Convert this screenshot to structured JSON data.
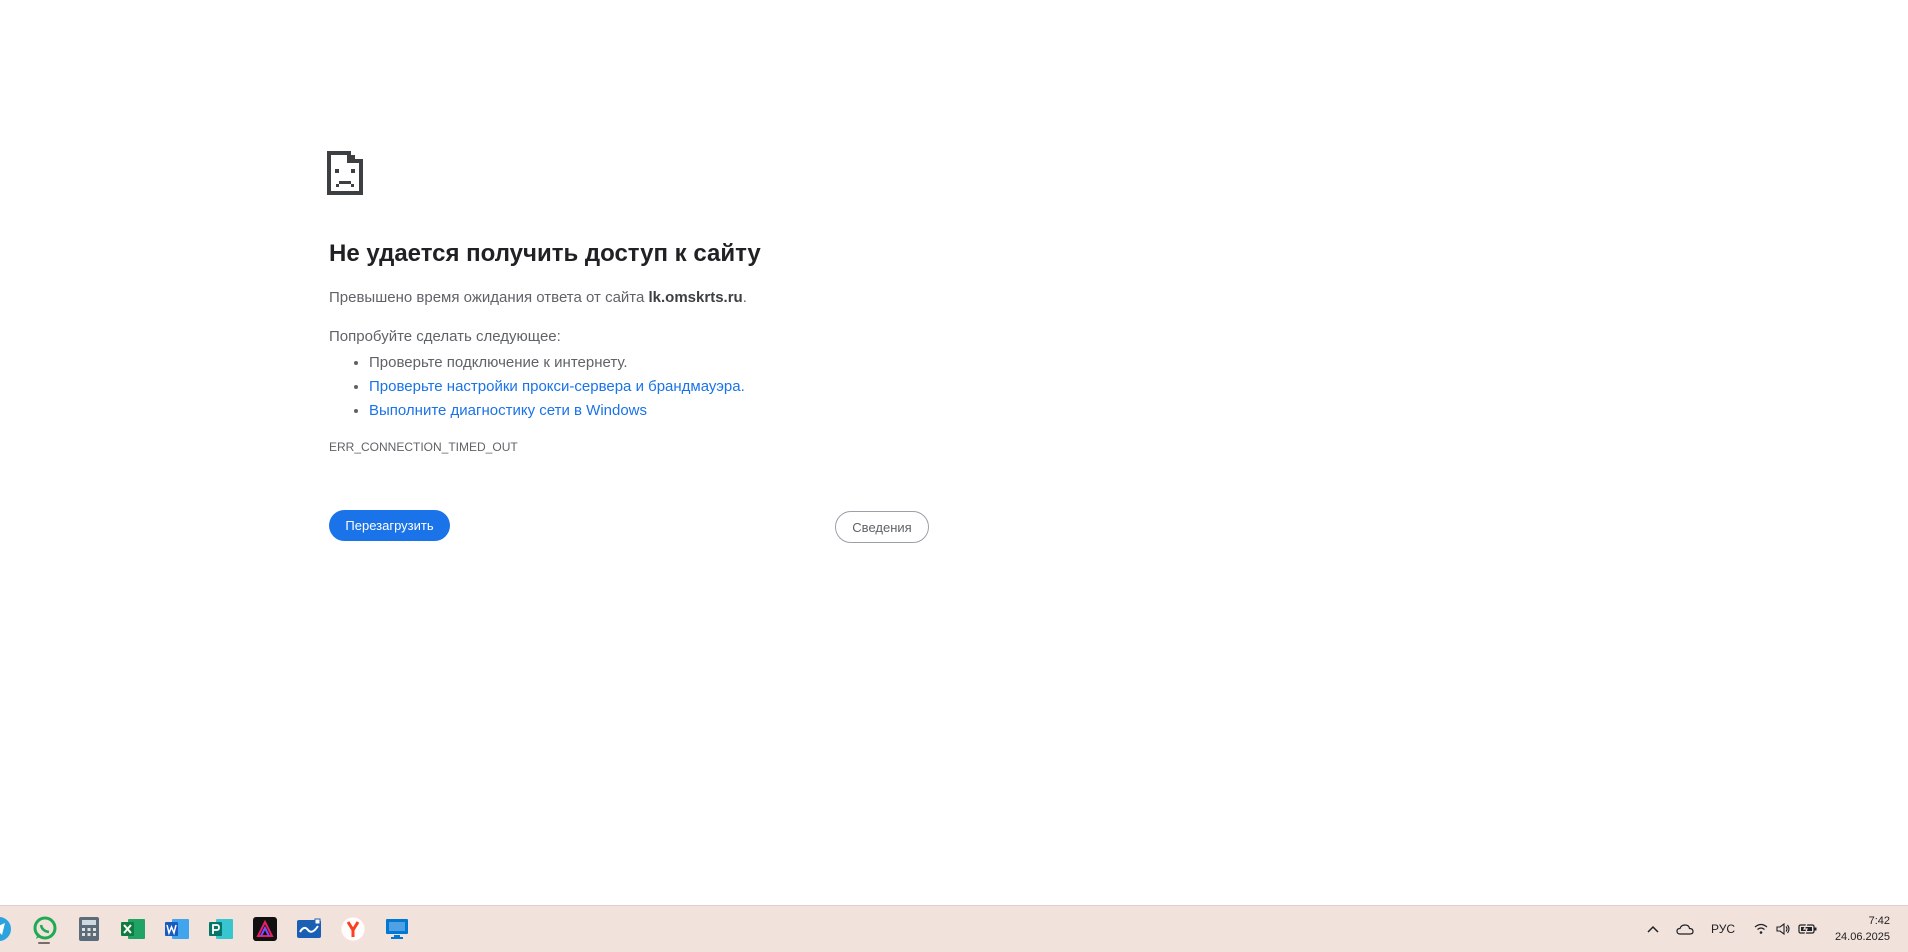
{
  "error": {
    "title": "Не удается получить доступ к сайту",
    "description_prefix": "Превышено время ожидания ответа от сайта ",
    "site": "lk.omskrts.ru",
    "description_suffix": ".",
    "try_heading": "Попробуйте сделать следующее:",
    "suggestions": [
      "Проверьте подключение к интернету.",
      "Проверьте настройки прокси-сервера и брандмауэра.",
      "Выполните диагностику сети в Windows"
    ],
    "code": "ERR_CONNECTION_TIMED_OUT",
    "reload_label": "Перезагрузить",
    "details_label": "Сведения"
  },
  "taskbar": {
    "apps": [
      "telegram-icon",
      "whatsapp-icon",
      "calculator-icon",
      "excel-icon",
      "word-icon",
      "publisher-icon",
      "affinity-icon",
      "whiteboard-icon",
      "yandex-browser-icon",
      "remote-desktop-icon"
    ],
    "language": "РУС",
    "time": "7:42",
    "date": "24.06.2025"
  },
  "colors": {
    "accent": "#1a73e8",
    "taskbar": "#f2e2dc"
  }
}
